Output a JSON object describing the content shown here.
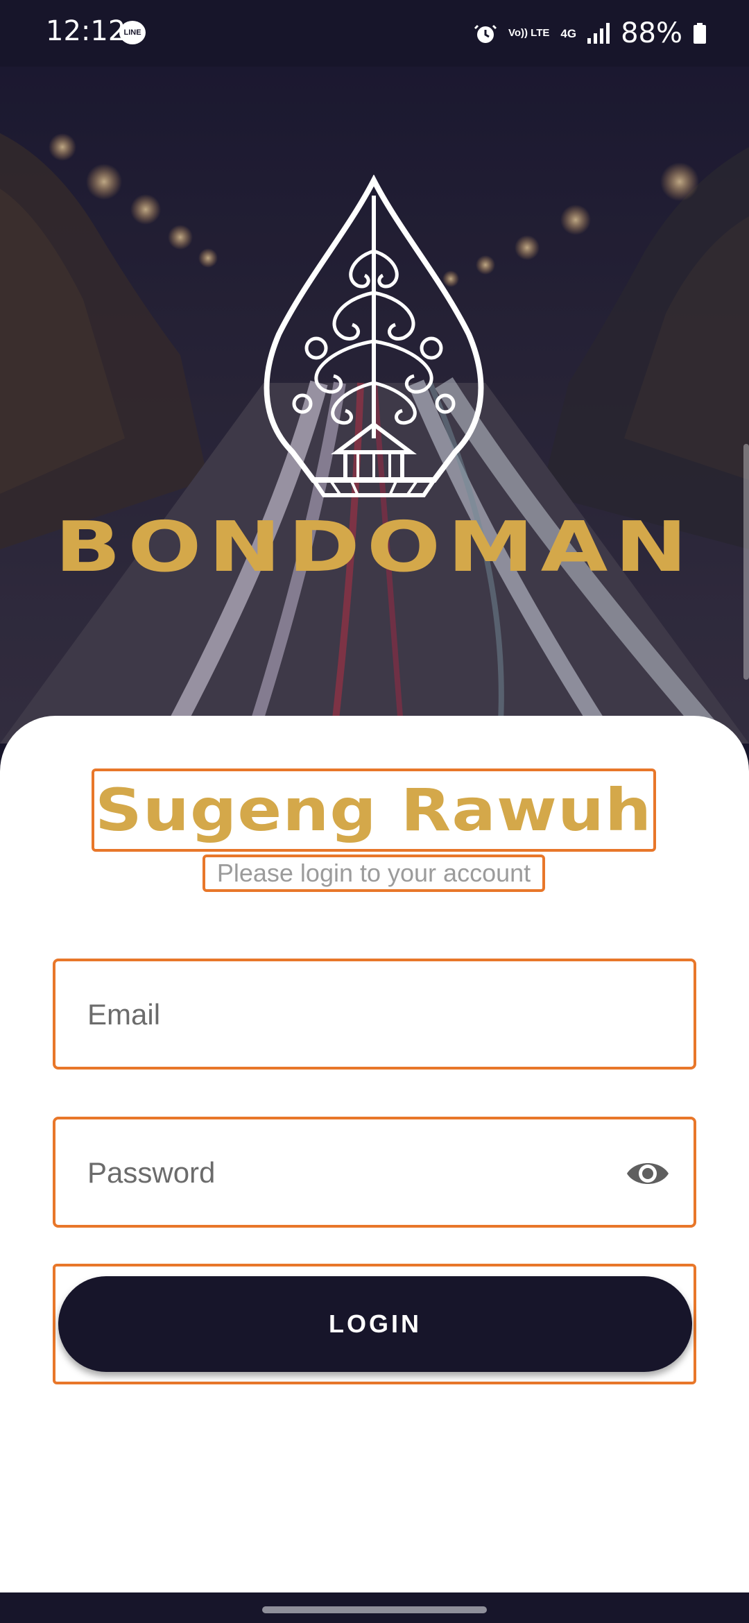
{
  "status_bar": {
    "time": "12:12",
    "notification_icon": "line-app-icon",
    "line_label": "LINE",
    "volte_label": "Vo)) LTE",
    "network_label": "4G",
    "battery_percent": "88%"
  },
  "hero": {
    "brand_name": "BONDOMAN",
    "logo_icon": "gunungan-wayang-logo",
    "background": "night-highway-light-trails"
  },
  "login_card": {
    "welcome_title": "Sugeng Rawuh",
    "subtitle": "Please login to your account",
    "email_placeholder": "Email",
    "password_placeholder": "Password",
    "password_toggle_icon": "eye-icon",
    "login_button_label": "LOGIN"
  },
  "colors": {
    "brand_gold": "#d4a84a",
    "dark_navy": "#17152a",
    "highlight_orange": "#e8772a",
    "subtitle_gray": "#9b9b9b"
  }
}
